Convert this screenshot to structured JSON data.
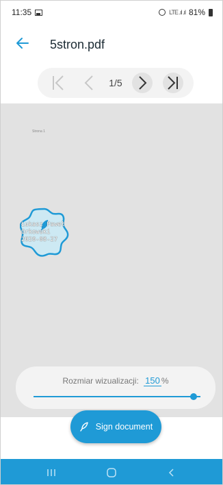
{
  "status_bar": {
    "time": "11:35",
    "network": "LTE",
    "battery": "81%"
  },
  "app_bar": {
    "title": "5stron.pdf"
  },
  "pager": {
    "indicator": "1/5"
  },
  "document": {
    "page_label": "Strona 1",
    "signature_lines": [
      "Łukasz Paweł",
      "Orkowski",
      "2020-08-27"
    ]
  },
  "size_panel": {
    "label": "Rozmiar wizualizacji:",
    "value": "150",
    "unit": "%",
    "slider_fraction": 0.96
  },
  "sign_button": {
    "label": "Sign document"
  },
  "colors": {
    "accent": "#1f9ad6",
    "doc_background": "#e2e2e2",
    "stamp_fill": "#cde9f3"
  },
  "icons": {
    "back": "arrow-left-icon",
    "first": "first-page-icon",
    "prev": "chevron-left-icon",
    "next": "chevron-right-icon",
    "last": "last-page-icon",
    "stamp": "feather-icon",
    "sign": "feather-icon",
    "nav_recent": "recent-apps-icon",
    "nav_home": "home-icon",
    "nav_back": "back-icon"
  }
}
